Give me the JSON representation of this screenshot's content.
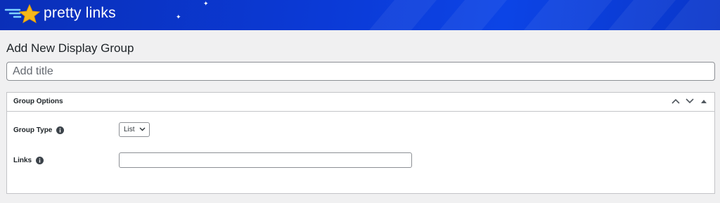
{
  "brand": {
    "logo_text": "pretty links",
    "banner_color": "#0b3ad6",
    "star_color": "#f5b81a"
  },
  "page": {
    "title": "Add New Display Group"
  },
  "title_field": {
    "placeholder": "Add title",
    "value": ""
  },
  "metabox": {
    "title": "Group Options",
    "actions": [
      "move-up-icon",
      "move-down-icon",
      "toggle-panel-icon"
    ],
    "fields": {
      "group_type": {
        "label": "Group Type",
        "selected": "List",
        "icon": "info-icon"
      },
      "links": {
        "label": "Links",
        "value": "",
        "icon": "info-icon"
      }
    }
  }
}
